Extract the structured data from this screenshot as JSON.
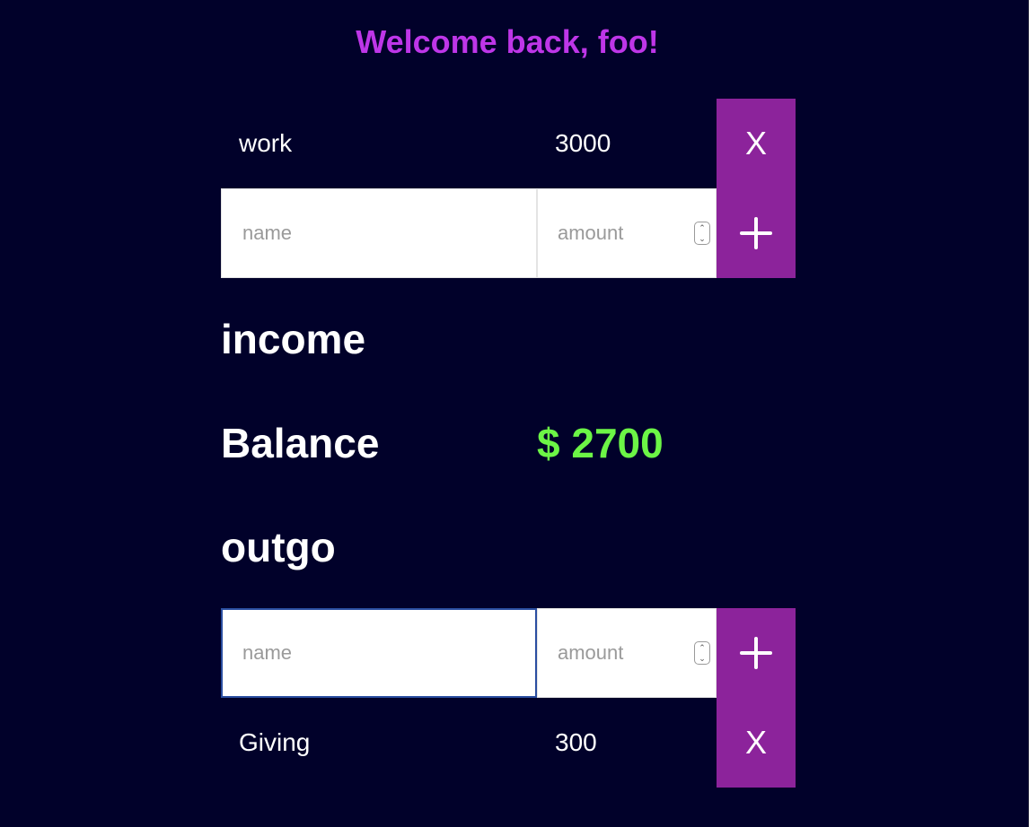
{
  "header": {
    "welcome": "Welcome back, foo!"
  },
  "income": {
    "heading": "income",
    "items": [
      {
        "name": "work",
        "amount": "3000",
        "delete_label": "X"
      }
    ],
    "form": {
      "name_placeholder": "name",
      "amount_placeholder": "amount",
      "add_icon": "plus-icon"
    }
  },
  "balance": {
    "label": "Balance",
    "value": "$ 2700"
  },
  "outgo": {
    "heading": "outgo",
    "form": {
      "name_placeholder": "name",
      "amount_placeholder": "amount",
      "add_icon": "plus-icon"
    },
    "items": [
      {
        "name": "Giving",
        "amount": "300",
        "delete_label": "X"
      }
    ]
  },
  "colors": {
    "background": "#01012a",
    "accent": "#8c239b",
    "welcome": "#be36e8",
    "balance_positive": "#6cf546"
  }
}
